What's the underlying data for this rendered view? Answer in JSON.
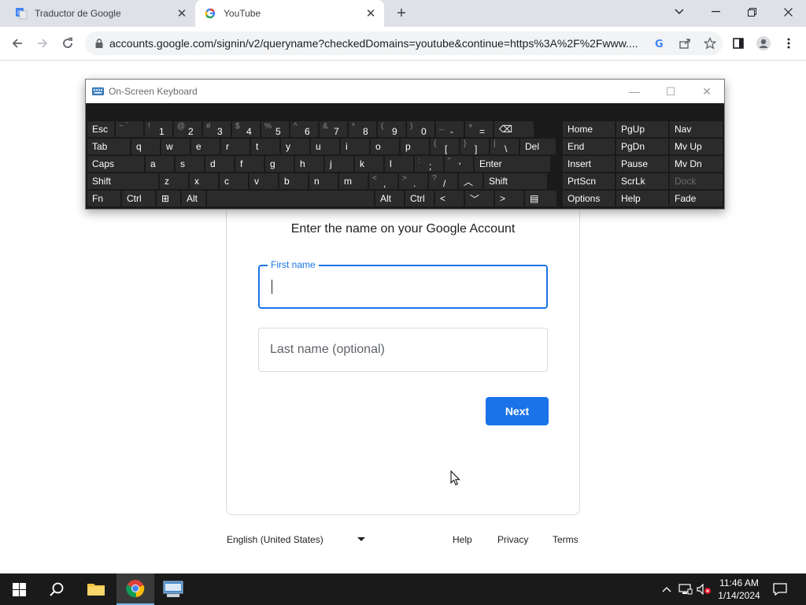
{
  "browser": {
    "tabs": [
      {
        "title": "Traductor de Google",
        "favicon": "google-translate-icon",
        "active": false
      },
      {
        "title": "YouTube",
        "favicon": "google-g-icon",
        "active": true
      }
    ],
    "url": "accounts.google.com/signin/v2/queryname?checkedDomains=youtube&continue=https%3A%2F%2Fwww...."
  },
  "osk": {
    "title": "On-Screen Keyboard",
    "rows": [
      [
        {
          "label": "Esc"
        },
        {
          "shift": "~ `",
          "main": ""
        },
        {
          "shift": "!",
          "main": "1"
        },
        {
          "shift": "@",
          "main": "2"
        },
        {
          "shift": "#",
          "main": "3"
        },
        {
          "shift": "$",
          "main": "4"
        },
        {
          "shift": "%",
          "main": "5"
        },
        {
          "shift": "^",
          "main": "6"
        },
        {
          "shift": "&",
          "main": "7"
        },
        {
          "shift": "*",
          "main": "8"
        },
        {
          "shift": "(",
          "main": "9"
        },
        {
          "shift": ")",
          "main": "0"
        },
        {
          "shift": "_",
          "main": "-"
        },
        {
          "shift": "+",
          "main": "="
        },
        {
          "label": "⌫"
        }
      ],
      [
        {
          "label": "Tab"
        },
        {
          "label": "q"
        },
        {
          "label": "w"
        },
        {
          "label": "e"
        },
        {
          "label": "r"
        },
        {
          "label": "t"
        },
        {
          "label": "y"
        },
        {
          "label": "u"
        },
        {
          "label": "i"
        },
        {
          "label": "o"
        },
        {
          "label": "p"
        },
        {
          "shift": "{",
          "main": "["
        },
        {
          "shift": "}",
          "main": "]"
        },
        {
          "shift": "|",
          "main": "\\"
        },
        {
          "label": "Del"
        }
      ],
      [
        {
          "label": "Caps"
        },
        {
          "label": "a"
        },
        {
          "label": "s"
        },
        {
          "label": "d"
        },
        {
          "label": "f"
        },
        {
          "label": "g"
        },
        {
          "label": "h"
        },
        {
          "label": "j"
        },
        {
          "label": "k"
        },
        {
          "label": "l"
        },
        {
          "shift": ":",
          "main": ";"
        },
        {
          "shift": "\"",
          "main": "'"
        },
        {
          "label": "Enter"
        }
      ],
      [
        {
          "label": "Shift"
        },
        {
          "label": "z"
        },
        {
          "label": "x"
        },
        {
          "label": "c"
        },
        {
          "label": "v"
        },
        {
          "label": "b"
        },
        {
          "label": "n"
        },
        {
          "label": "m"
        },
        {
          "shift": "<",
          "main": ","
        },
        {
          "shift": ">",
          "main": "."
        },
        {
          "shift": "?",
          "main": "/"
        },
        {
          "label": "︿"
        },
        {
          "label": "Shift"
        }
      ],
      [
        {
          "label": "Fn"
        },
        {
          "label": "Ctrl"
        },
        {
          "label": "⊞"
        },
        {
          "label": "Alt"
        },
        {
          "label": ""
        },
        {
          "label": "Alt"
        },
        {
          "label": "Ctrl"
        },
        {
          "label": "<"
        },
        {
          "label": "﹀"
        },
        {
          "label": ">"
        },
        {
          "label": "▤"
        }
      ]
    ],
    "nav_keys": [
      [
        "Home",
        "PgUp",
        "Nav"
      ],
      [
        "End",
        "PgDn",
        "Mv Up"
      ],
      [
        "Insert",
        "Pause",
        "Mv Dn"
      ],
      [
        "PrtScn",
        "ScrLk",
        "Dock"
      ],
      [
        "Options",
        "Help",
        "Fade"
      ]
    ]
  },
  "page": {
    "subtitle": "Enter the name on your Google Account",
    "first_name_label": "First name",
    "first_name_value": "",
    "last_name_placeholder": "Last name (optional)",
    "next_label": "Next"
  },
  "footer": {
    "language": "English (United States)",
    "help": "Help",
    "privacy": "Privacy",
    "terms": "Terms"
  },
  "taskbar": {
    "time": "11:46 AM",
    "date": "1/14/2024"
  },
  "colors": {
    "accent": "#1a73e8",
    "osk_bg": "#1a1a1a",
    "osk_key": "#2b2b2b",
    "taskbar": "#1a1a1a"
  }
}
